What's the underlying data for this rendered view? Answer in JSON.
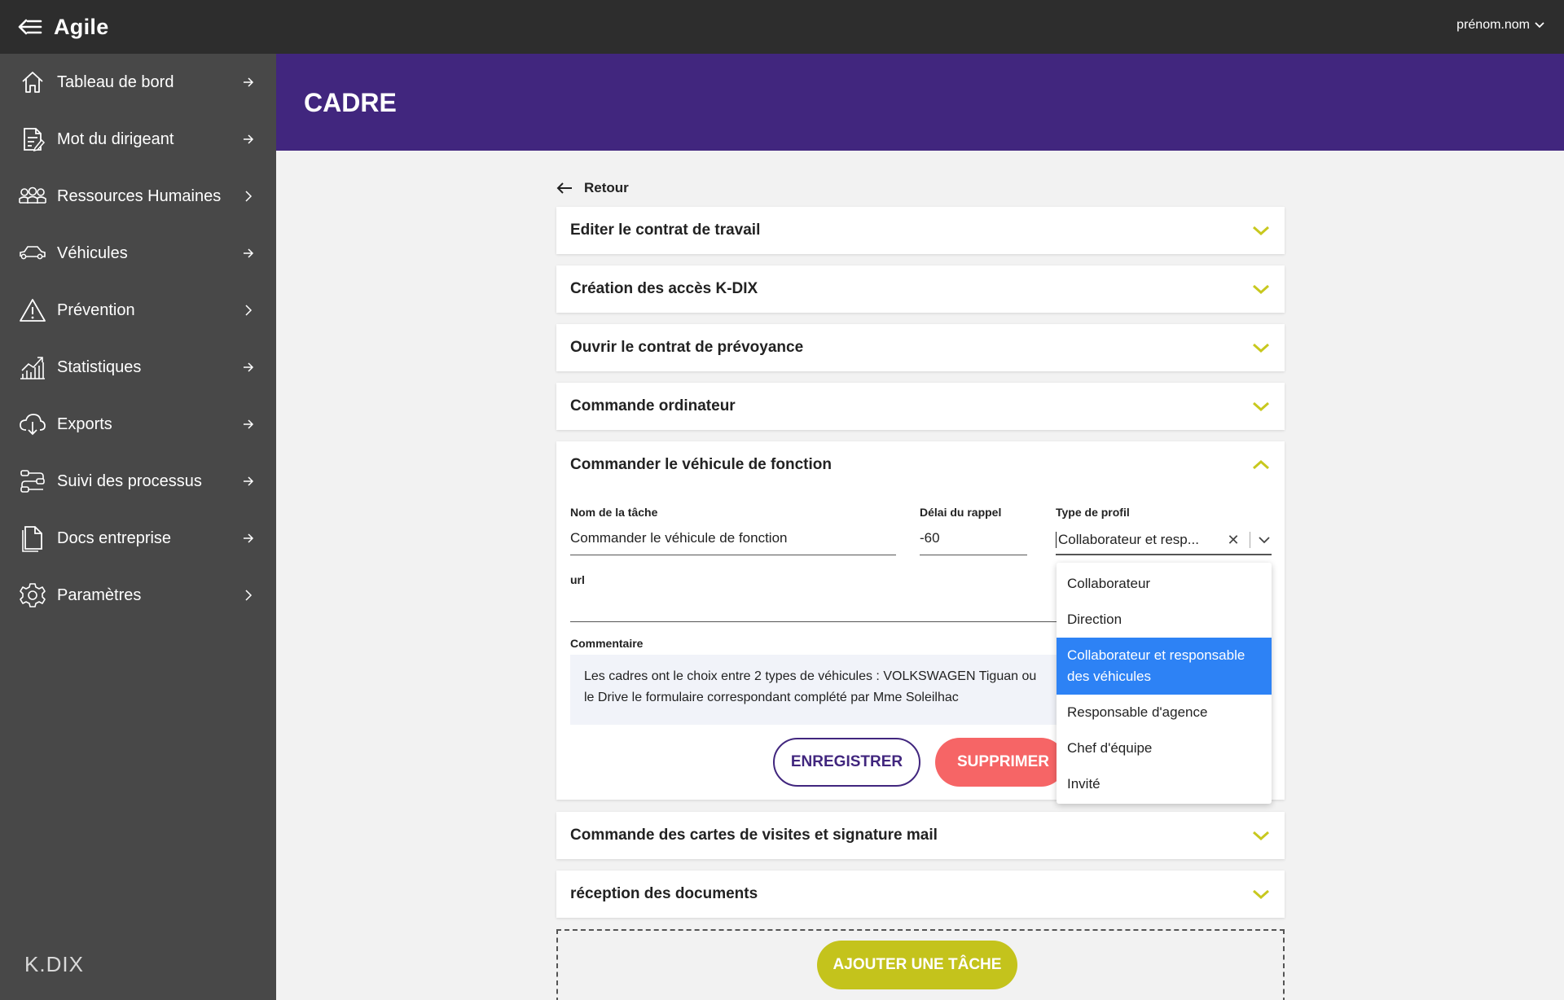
{
  "app": {
    "title": "Agile",
    "user": "prénom.nom"
  },
  "sidebar": {
    "items": [
      {
        "label": "Tableau de bord",
        "icon": "home-icon"
      },
      {
        "label": "Mot du dirigeant",
        "icon": "document-edit-icon"
      },
      {
        "label": "Ressources Humaines",
        "icon": "people-icon"
      },
      {
        "label": "Véhicules",
        "icon": "car-icon"
      },
      {
        "label": "Prévention",
        "icon": "warning-icon"
      },
      {
        "label": "Statistiques",
        "icon": "chart-icon"
      },
      {
        "label": "Exports",
        "icon": "download-cloud-icon"
      },
      {
        "label": "Suivi des processus",
        "icon": "process-icon"
      },
      {
        "label": "Docs entreprise",
        "icon": "file-icon"
      },
      {
        "label": "Paramètres",
        "icon": "gear-icon"
      }
    ],
    "brand": "K.DIX"
  },
  "header": {
    "title": "CADRE"
  },
  "main": {
    "back_label": "Retour",
    "accordions": [
      {
        "title": "Editer le contrat de travail",
        "expanded": false
      },
      {
        "title": "Création des accès K-DIX",
        "expanded": false
      },
      {
        "title": "Ouvrir le contrat de prévoyance",
        "expanded": false
      },
      {
        "title": "Commande ordinateur",
        "expanded": false
      },
      {
        "title": "Commander le véhicule de fonction",
        "expanded": true
      },
      {
        "title": "Commande des cartes de visites et signature mail",
        "expanded": false
      },
      {
        "title": "réception des documents",
        "expanded": false
      }
    ],
    "form": {
      "task_name_label": "Nom de la tâche",
      "task_name_value": "Commander le véhicule de fonction",
      "delay_label": "Délai du rappel",
      "delay_value": "-60",
      "profile_label": "Type de profil",
      "profile_value": "Collaborateur et resp...",
      "url_label": "url",
      "url_value": "",
      "comment_label": "Commentaire",
      "comment_line1": "Les cadres ont le choix entre 2 types de véhicules : VOLKSWAGEN Tiguan ou",
      "comment_line2": "le Drive le formulaire correspondant complété par Mme Soleilhac",
      "save_label": "ENREGISTRER",
      "delete_label": "SUPPRIMER"
    },
    "profile_options": [
      "Collaborateur",
      "Direction",
      "Collaborateur et responsable des véhicules",
      "Responsable d'agence",
      "Chef d'équipe",
      "Invité"
    ],
    "profile_selected_index": 2,
    "add_task_label": "AJOUTER UNE TÂCHE"
  },
  "colors": {
    "topbar": "#2d2d2d",
    "sidebar": "#484848",
    "header": "#41267e",
    "accent_chevron": "#c8c81e",
    "delete": "#f66566",
    "add": "#c4c31c",
    "selected_option": "#2d82f5"
  }
}
